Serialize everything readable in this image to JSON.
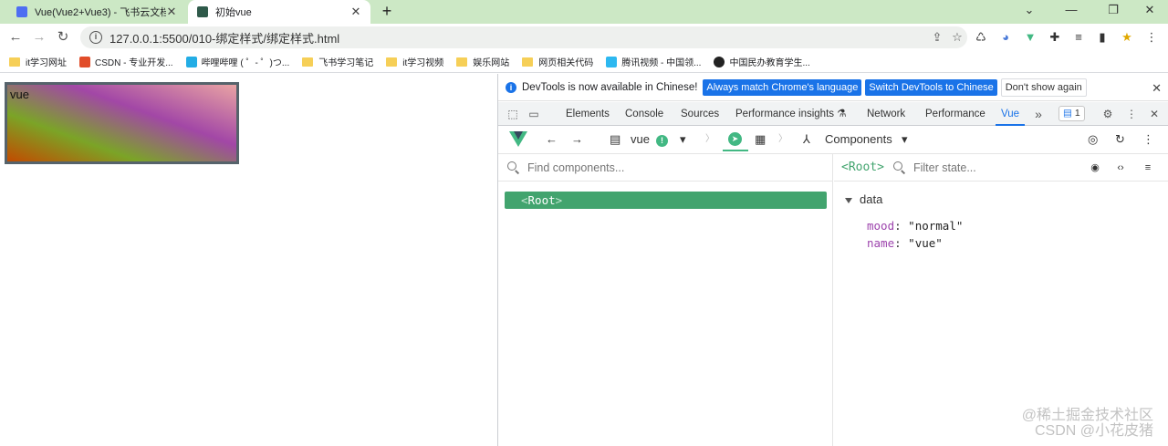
{
  "tabs": [
    {
      "title": "Vue(Vue2+Vue3) - 飞书云文档",
      "close": "✕",
      "favicon_color": "#4e6ef2"
    },
    {
      "title": "初始vue",
      "close": "✕",
      "favicon_color": "#2f5a4a"
    }
  ],
  "new_tab": "+",
  "window_controls": {
    "chevron": "⌄",
    "minimize": "—",
    "restore": "❐",
    "close": "✕"
  },
  "nav": {
    "back": "←",
    "forward": "→",
    "reload": "↻"
  },
  "address": {
    "url": "127.0.0.1:5500/010-绑定样式/绑定样式.html",
    "info": "i",
    "share": "⇪",
    "star": "☆"
  },
  "extensions": [
    "♺",
    "◕",
    "▼",
    "✚",
    "≡",
    "▮",
    "★",
    "⋮"
  ],
  "bookmarks": [
    {
      "label": "it学习网址",
      "icon": "folder"
    },
    {
      "label": "CSDN - 专业开发...",
      "icon": "csdn",
      "color": "#e14d2a"
    },
    {
      "label": "哔哩哔哩 ( ゜- ゜)つ...",
      "icon": "bili",
      "color": "#23ade5"
    },
    {
      "label": "飞书学习笔记",
      "icon": "folder"
    },
    {
      "label": "it学习视频",
      "icon": "folder"
    },
    {
      "label": "娱乐网站",
      "icon": "folder"
    },
    {
      "label": "网页相关代码",
      "icon": "folder"
    },
    {
      "label": "腾讯视频 - 中国领...",
      "icon": "tx",
      "color": "#2db8f0"
    },
    {
      "label": "中国民办教育学生...",
      "icon": "globe",
      "color": "#222222"
    }
  ],
  "page": {
    "box_text": "vue"
  },
  "devtools": {
    "banner": {
      "info": "i",
      "message": "DevTools is now available in Chinese!",
      "btn_match": "Always match Chrome's language",
      "btn_switch": "Switch DevTools to Chinese",
      "btn_dont": "Don't show again",
      "close": "✕"
    },
    "tabs": [
      "Elements",
      "Console",
      "Sources",
      "Performance insights ⚗",
      "Network",
      "Performance",
      "Vue"
    ],
    "more": "»",
    "issues_count": "1",
    "issues_icon": "▤",
    "settings": "⚙",
    "kebab": "⋮",
    "close": "✕",
    "inspect": "⬚",
    "device": "▭"
  },
  "vue_toolbar": {
    "back": "←",
    "forward": "→",
    "app_icon": "▤",
    "app_name": "vue",
    "app_badge": "!",
    "app_caret": "▾",
    "sep": "〉",
    "timeline_icon": "▦",
    "components_icon": "⅄",
    "components_label": "Components",
    "components_caret": "▾",
    "target": "◎",
    "refresh": "↻",
    "more": "⋮"
  },
  "components": {
    "search_placeholder": "Find components...",
    "root_open": "<",
    "root_name": "Root",
    "root_close": ">"
  },
  "inspector": {
    "selected": "<Root>",
    "filter_placeholder": "Filter state...",
    "icons": {
      "eye": "◉",
      "code": "‹›",
      "collapse": "≡"
    },
    "section": "data",
    "props": [
      {
        "key": "mood",
        "value": "\"normal\""
      },
      {
        "key": "name",
        "value": "\"vue\""
      }
    ]
  },
  "watermark": {
    "line1": "@稀土掘金技术社区",
    "line2": "CSDN @小花皮猪"
  }
}
